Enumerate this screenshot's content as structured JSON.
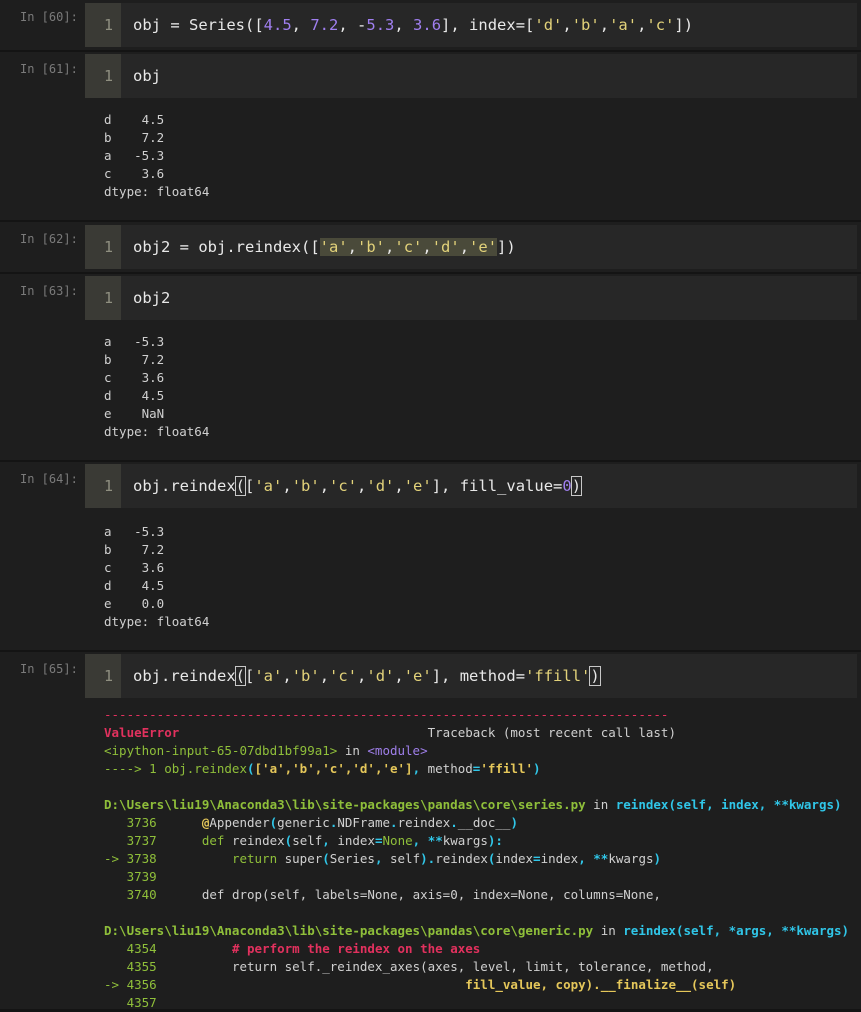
{
  "cells": [
    {
      "prompt": "In [60]:",
      "line": "1"
    },
    {
      "prompt": "In [61]:",
      "line": "1",
      "code": "obj",
      "output": [
        "d    4.5",
        "b    7.2",
        "a   -5.3",
        "c    3.6",
        "dtype: float64"
      ]
    },
    {
      "prompt": "In [62]:",
      "line": "1"
    },
    {
      "prompt": "In [63]:",
      "line": "1",
      "code": "obj2",
      "output": [
        "a   -5.3",
        "b    7.2",
        "c    3.6",
        "d    4.5",
        "e    NaN",
        "dtype: float64"
      ]
    },
    {
      "prompt": "In [64]:",
      "line": "1",
      "output": [
        "a   -5.3",
        "b    7.2",
        "c    3.6",
        "d    4.5",
        "e    0.0",
        "dtype: float64"
      ]
    },
    {
      "prompt": "In [65]:",
      "line": "1"
    }
  ],
  "traceback": {
    "dashes": "---------------------------------------------------------------------------",
    "error": "ValueError",
    "header": "Traceback (most recent call last)",
    "input": "<ipython-input-65-07dbd1bf99a1>",
    "in_word": " in ",
    "module": "<module>",
    "arrow_line_prefix": "----> 1 obj.reindex",
    "file1": "D:\\Users\\liu19\\Anaconda3\\lib\\site-packages\\pandas\\core\\series.py",
    "file1_func": "reindex",
    "file1_args": "(self, index, **kwargs)",
    "file2": "D:\\Users\\liu19\\Anaconda3\\lib\\site-packages\\pandas\\core\\generic.py",
    "file2_func": "reindex",
    "file2_args": "(self, *args, **kwargs)",
    "comment": "# perform the reindex on the axes"
  }
}
